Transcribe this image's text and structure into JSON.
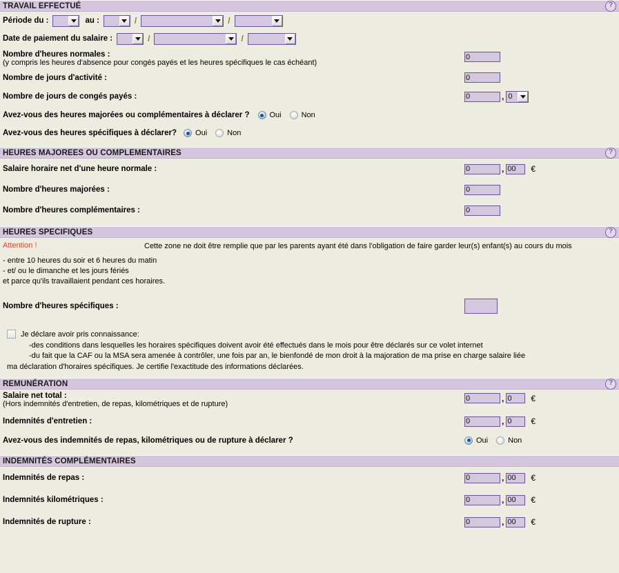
{
  "colors": {
    "section_bar": "#d5c5de",
    "page_background": "#ecece0",
    "field_background": "#d3c8de",
    "field_border": "#6d4f9c",
    "attention_red": "#e8402a",
    "slash_olive": "#8a7a2a",
    "radio_selected": "#15538f"
  },
  "icons": {
    "help": "?",
    "dropdown_arrow": "▼"
  },
  "sections": {
    "travail": {
      "title": "TRAVAIL EFFECTUÉ",
      "help_label": "?",
      "periode_label": "Période du :",
      "periode_au_label": "au :",
      "periode_du_value": "",
      "periode_au_day_value": "",
      "periode_au_month_value": "",
      "periode_au_year_value": "",
      "date_paiement_label": "Date de paiement du salaire :",
      "date_paiement_day_value": "",
      "date_paiement_month_value": "",
      "date_paiement_year_value": "",
      "separator": "/",
      "heures_normales_label": "Nombre d'heures normales :",
      "heures_normales_sub": "(y compris les heures d'absence pour congés payés et les heures spécifiques le cas échéant)",
      "heures_normales_value": "0",
      "jours_activite_label": "Nombre de jours d'activité :",
      "jours_activite_value": "0",
      "jours_conges_label": "Nombre de jours de congés payés :",
      "jours_conges_value": "0",
      "jours_conges_decimal_value": "0",
      "decimal_comma": ",",
      "q_majorees_label": "Avez-vous des heures majorées ou complémentaires à déclarer ?",
      "q_majorees_oui": "Oui",
      "q_majorees_non": "Non",
      "q_majorees_selected": "Oui",
      "q_specifiques_label": "Avez-vous des heures spécifiques à déclarer?",
      "q_specifiques_oui": "Oui",
      "q_specifiques_non": "Non",
      "q_specifiques_selected": "Oui"
    },
    "heures_majorees": {
      "title": "HEURES MAJOREES OU COMPLEMENTAIRES",
      "help_label": "?",
      "salaire_horaire_label": "Salaire horaire net d'une heure normale :",
      "salaire_horaire_value": "0",
      "salaire_horaire_decimal": "00",
      "euro": "€",
      "comma": ",",
      "heures_majorees_label": "Nombre d'heures majorées :",
      "heures_majorees_value": "0",
      "heures_complementaires_label": "Nombre d'heures complémentaires :",
      "heures_complementaires_value": "0"
    },
    "heures_specifiques": {
      "title": "HEURES SPECIFIQUES",
      "help_label": "?",
      "attention_label": "Attention !",
      "attention_text": "Cette zone ne doit être remplie que par les parents ayant été dans l'obligation de faire garder leur(s) enfant(s) au cours du mois",
      "condition_1": "- entre 10 heures du soir et 6 heures du matin",
      "condition_2": "- et/ ou le dimanche et les jours fériés",
      "condition_3": "et parce qu'ils travaillaient pendant ces horaires.",
      "heures_specifiques_label": "Nombre d'heures spécifiques :",
      "heures_specifiques_value": "",
      "declaration_intro": "Je déclare avoir pris connaissance:",
      "declaration_line_1": "-des conditions dans lesquelles les horaires spécifiques doivent avoir été effectués dans le mois pour être déclarés sur ce volet internet",
      "declaration_line_2": "-du fait que la CAF ou la MSA sera amenée à contrôler, une fois par an, le bienfondé de mon droit à la majoration de ma prise en charge salaire liée",
      "declaration_line_3": "ma déclaration d'horaires spécifiques. Je certifie l'exactitude des informations déclarées.",
      "declaration_checked": false
    },
    "remuneration": {
      "title": "REMUNÉRATION",
      "help_label": "?",
      "salaire_net_label": "Salaire net total :",
      "salaire_net_sub": "(Hors indemnités d'entretien, de repas, kilométriques et de rupture)",
      "salaire_net_value": "0",
      "salaire_net_decimal": "0",
      "indemnites_entretien_label": "Indemnités d'entretien :",
      "indemnites_entretien_value": "0",
      "indemnites_entretien_decimal": "0",
      "euro": "€",
      "comma": ",",
      "q_indemnites_label": "Avez-vous des indemnités de repas, kilométriques ou de rupture à déclarer ?",
      "q_indemnites_oui": "Oui",
      "q_indemnites_non": "Non",
      "q_indemnites_selected": "Oui"
    },
    "indemnites_complementaires": {
      "title": "INDEMNITÉS COMPLÉMENTAIRES",
      "repas_label": "Indemnités de repas :",
      "repas_value": "0",
      "repas_decimal": "00",
      "kilometriques_label": "Indemnités kilométriques :",
      "kilometriques_value": "0",
      "kilometriques_decimal": "00",
      "rupture_label": "Indemnités de rupture :",
      "rupture_value": "0",
      "rupture_decimal": "00",
      "euro": "€",
      "comma": ","
    }
  }
}
